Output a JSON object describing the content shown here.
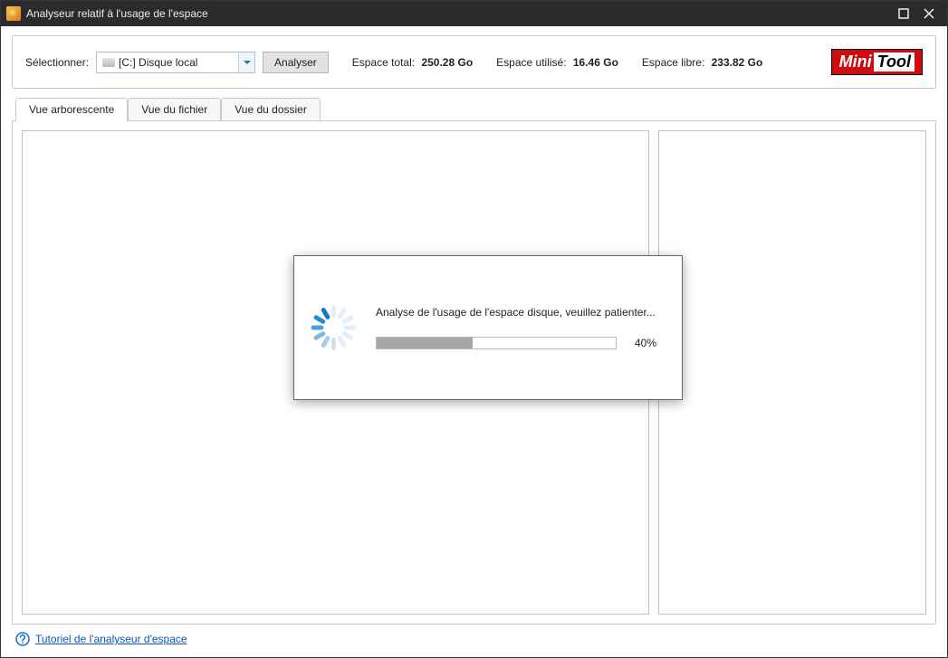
{
  "window": {
    "title": "Analyseur relatif à l'usage de l'espace"
  },
  "toolbar": {
    "select_label": "Sélectionner:",
    "drive_text": "[C:] Disque local",
    "analyze_label": "Analyser",
    "total_label": "Espace total:",
    "total_value": "250.28 Go",
    "used_label": "Espace utilisé:",
    "used_value": "16.46 Go",
    "free_label": "Espace libre:",
    "free_value": "233.82 Go"
  },
  "logo": {
    "part1": "Mini",
    "part2": "Tool"
  },
  "tabs": [
    {
      "label": "Vue arborescente",
      "active": true
    },
    {
      "label": "Vue du fichier",
      "active": false
    },
    {
      "label": "Vue du dossier",
      "active": false
    }
  ],
  "footer": {
    "tutorial_link": "Tutoriel de l'analyseur d'espace"
  },
  "modal": {
    "message": "Analyse de l'usage de l'espace disque, veuillez patienter...",
    "progress_pct": 40,
    "progress_label": "40%"
  }
}
